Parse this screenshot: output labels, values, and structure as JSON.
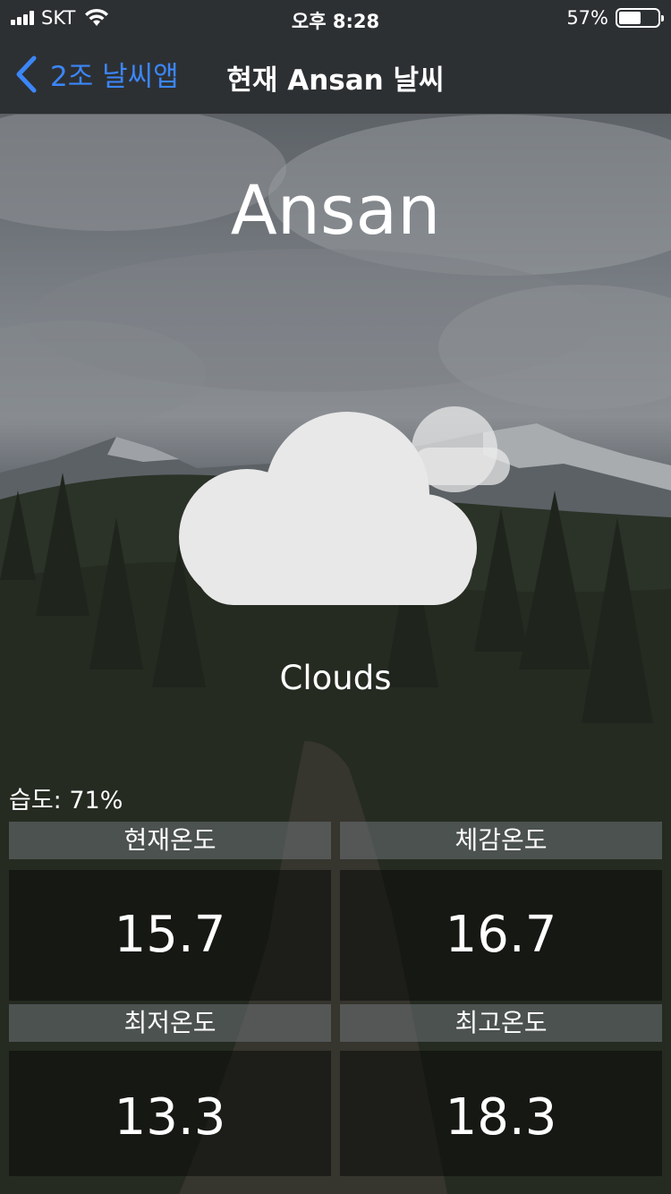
{
  "status_bar": {
    "carrier": "SKT",
    "time": "오후 8:28",
    "battery_percent": "57%",
    "battery_level": 0.57
  },
  "nav": {
    "back_label": "2조 날씨앱",
    "title": "현재 Ansan 날씨"
  },
  "weather": {
    "city": "Ansan",
    "icon": "cloud-icon",
    "condition": "Clouds",
    "humidity": "습도: 71%"
  },
  "stats": [
    {
      "label": "현재온도",
      "value": "15.7"
    },
    {
      "label": "체감온도",
      "value": "16.7"
    },
    {
      "label": "최저온도",
      "value": "13.3"
    },
    {
      "label": "최고온도",
      "value": "18.3"
    }
  ],
  "colors": {
    "accent": "#3b86f7",
    "bar_bg": "#2d3033",
    "cloud": "#e8e8e8"
  }
}
